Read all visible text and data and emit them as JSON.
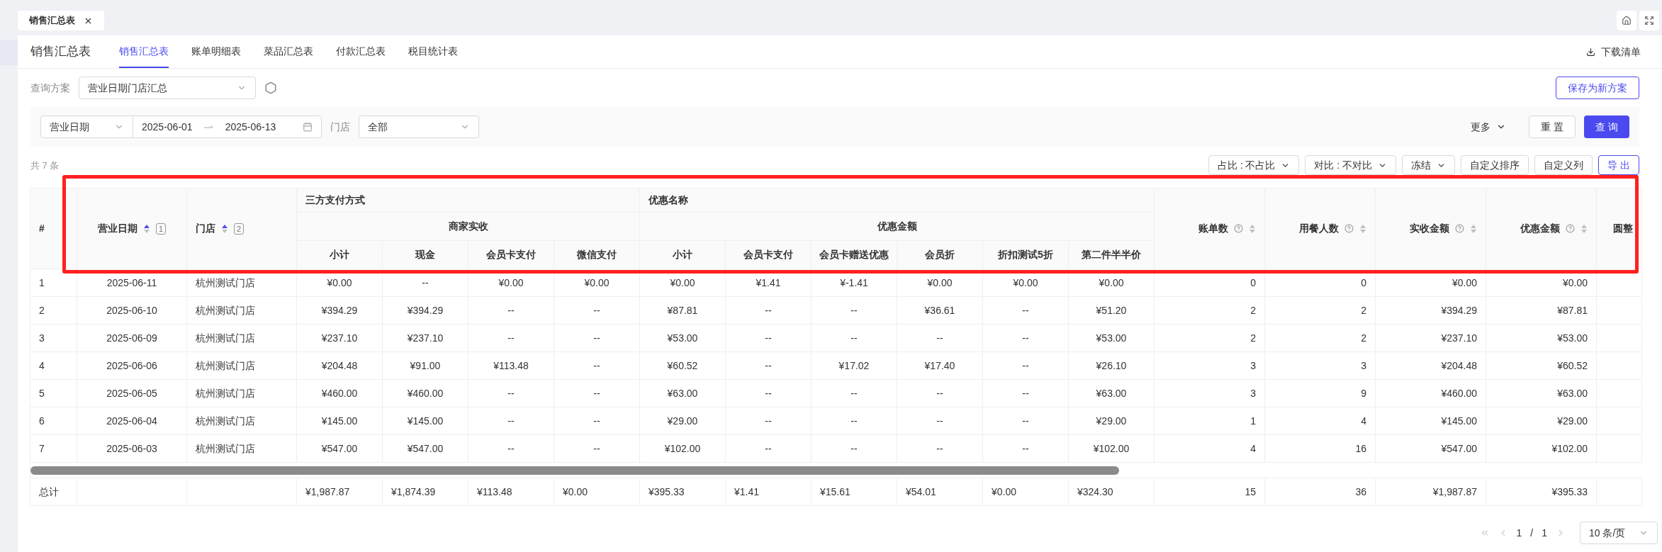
{
  "window_tabs": [
    {
      "label": "销售汇总表",
      "selected": true
    }
  ],
  "page": {
    "title": "销售汇总表",
    "download": "下载清单",
    "tabs": [
      {
        "label": "销售汇总表",
        "selected": true
      },
      {
        "label": "账单明细表",
        "selected": false
      },
      {
        "label": "菜品汇总表",
        "selected": false
      },
      {
        "label": "付款汇总表",
        "selected": false
      },
      {
        "label": "税目统计表",
        "selected": false
      }
    ]
  },
  "query_scheme": {
    "label": "查询方案",
    "value": "营业日期门店汇总",
    "save_button": "保存为新方案"
  },
  "filters": {
    "date_type": "营业日期",
    "start": "2025-06-01",
    "end": "2025-06-13",
    "store_label": "门店",
    "store": "全部",
    "more": "更多",
    "reset": "重 置",
    "search": "查 询"
  },
  "summary": "共 7 条",
  "toolbar": [
    {
      "label": "占比 : 不占比",
      "kind": "dropdown"
    },
    {
      "label": "对比 : 不对比",
      "kind": "dropdown"
    },
    {
      "label": "冻结",
      "kind": "dropdown"
    },
    {
      "label": "自定义排序",
      "kind": "plain"
    },
    {
      "label": "自定义列",
      "kind": "plain"
    },
    {
      "label": "导 出",
      "kind": "primary"
    }
  ],
  "table": {
    "fixed_columns": [
      {
        "label": "#",
        "kind": "index"
      },
      {
        "label": "营业日期",
        "kind": "dimension",
        "sorted_ascending": true,
        "sort_order": "1"
      },
      {
        "label": "门店",
        "kind": "dimension",
        "sorted_ascending": true,
        "sort_order": "2"
      }
    ],
    "group_row_1": [
      {
        "label": "三方支付方式"
      },
      {
        "label": "优惠名称"
      }
    ],
    "group_row_2": [
      {
        "label": "商家实收"
      },
      {
        "label": "优惠金额"
      }
    ],
    "leaf_columns": [
      "小计",
      "现金",
      "会员卡支付",
      "微信支付",
      "小计",
      "会员卡支付",
      "会员卡赠送优惠",
      "会员折",
      "折扣测试5折",
      "第二件半半价"
    ],
    "metric_columns": [
      {
        "label": "账单数",
        "help": true,
        "sortable": true
      },
      {
        "label": "用餐人数",
        "help": true,
        "sortable": true
      },
      {
        "label": "实收金额",
        "help": true,
        "sortable": true
      },
      {
        "label": "优惠金额",
        "help": true,
        "sortable": true
      },
      {
        "label": "圆整",
        "help": false,
        "sortable": false
      }
    ],
    "rows": [
      {
        "cells": [
          "1",
          "2025-06-11",
          "杭州测试门店",
          "¥0.00",
          "--",
          "¥0.00",
          "¥0.00",
          "¥0.00",
          "¥1.41",
          "¥-1.41",
          "¥0.00",
          "¥0.00",
          "¥0.00",
          "0",
          "0",
          "¥0.00",
          "¥0.00"
        ]
      },
      {
        "cells": [
          "2",
          "2025-06-10",
          "杭州测试门店",
          "¥394.29",
          "¥394.29",
          "--",
          "--",
          "¥87.81",
          "--",
          "--",
          "¥36.61",
          "--",
          "¥51.20",
          "2",
          "2",
          "¥394.29",
          "¥87.81"
        ]
      },
      {
        "cells": [
          "3",
          "2025-06-09",
          "杭州测试门店",
          "¥237.10",
          "¥237.10",
          "--",
          "--",
          "¥53.00",
          "--",
          "--",
          "--",
          "--",
          "¥53.00",
          "2",
          "2",
          "¥237.10",
          "¥53.00"
        ]
      },
      {
        "cells": [
          "4",
          "2025-06-06",
          "杭州测试门店",
          "¥204.48",
          "¥91.00",
          "¥113.48",
          "--",
          "¥60.52",
          "--",
          "¥17.02",
          "¥17.40",
          "--",
          "¥26.10",
          "3",
          "3",
          "¥204.48",
          "¥60.52"
        ]
      },
      {
        "cells": [
          "5",
          "2025-06-05",
          "杭州测试门店",
          "¥460.00",
          "¥460.00",
          "--",
          "--",
          "¥63.00",
          "--",
          "--",
          "--",
          "--",
          "¥63.00",
          "3",
          "9",
          "¥460.00",
          "¥63.00"
        ]
      },
      {
        "cells": [
          "6",
          "2025-06-04",
          "杭州测试门店",
          "¥145.00",
          "¥145.00",
          "--",
          "--",
          "¥29.00",
          "--",
          "--",
          "--",
          "--",
          "¥29.00",
          "1",
          "4",
          "¥145.00",
          "¥29.00"
        ]
      },
      {
        "cells": [
          "7",
          "2025-06-03",
          "杭州测试门店",
          "¥547.00",
          "¥547.00",
          "--",
          "--",
          "¥102.00",
          "--",
          "--",
          "--",
          "--",
          "¥102.00",
          "4",
          "16",
          "¥547.00",
          "¥102.00"
        ]
      }
    ],
    "total": {
      "label": "总计",
      "cells": [
        "¥1,987.87",
        "¥1,874.39",
        "¥113.48",
        "¥0.00",
        "¥395.33",
        "¥1.41",
        "¥15.61",
        "¥54.01",
        "¥0.00",
        "¥324.30",
        "15",
        "36",
        "¥1,987.87",
        "¥395.33"
      ]
    }
  },
  "pagination": {
    "current": "1",
    "separator": "/",
    "total": "1",
    "page_size": "10 条/页"
  }
}
